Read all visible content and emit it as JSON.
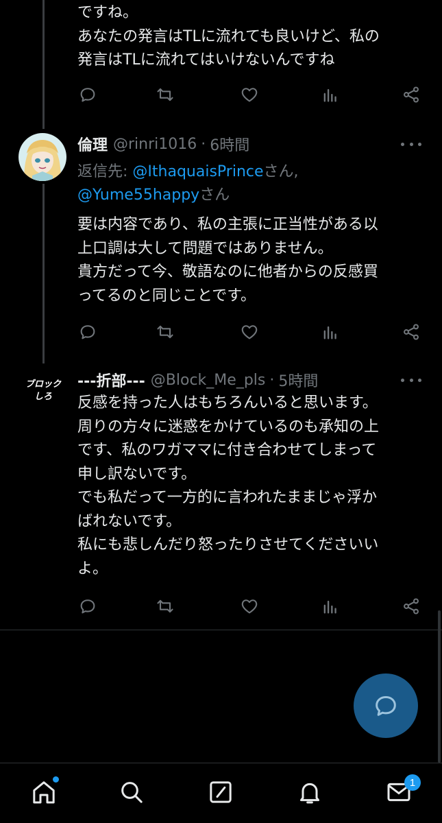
{
  "tweet_prev": {
    "lines": [
      "ですね。",
      "あなたの発言はTLに流れても良いけど、私の",
      "発言はTLに流れてはいけないんですね"
    ]
  },
  "tweet_rinri": {
    "name": "倫理",
    "handle": "@rinri1016",
    "sep": "·",
    "time": "6時間",
    "reply_prefix": "返信先:",
    "reply_user1": "@IthaquaisPrince",
    "reply_san1": "さん,",
    "reply_user2": "@Yume55happy",
    "reply_san2": "さん",
    "lines": [
      "要は内容であり、私の主張に正当性がある以",
      "上口調は大して問題ではありません。",
      "貴方だって今、敬語なのに他者からの反感買",
      "ってるのと同じことです。"
    ]
  },
  "tweet_block": {
    "name": "---折部---",
    "handle": "@Block_Me_pls",
    "sep": "·",
    "time": "5時間",
    "avatar_text_1": "ブロック",
    "avatar_text_2": "しろ",
    "lines": [
      "反感を持った人はもちろんいると思います。",
      "周りの方々に迷惑をかけているのも承知の上",
      "です、私のワガママに付き合わせてしまって",
      "申し訳ないです。",
      "でも私だって一方的に言われたままじゃ浮か",
      "ばれないです。",
      "私にも悲しんだり怒ったりさせてくださいい",
      "よ。"
    ]
  },
  "nav": {
    "messages_badge": "1"
  },
  "colors": {
    "background": "#000000",
    "text": "#e7e9ea",
    "muted": "#71767b",
    "link": "#1d9bf0",
    "fab": "#1a5a8a"
  },
  "icons": {
    "actions": [
      "reply-icon",
      "retweet-icon",
      "like-icon",
      "views-icon",
      "share-icon"
    ],
    "nav": [
      "home-icon",
      "search-icon",
      "compose-icon",
      "notifications-icon",
      "messages-icon"
    ]
  }
}
